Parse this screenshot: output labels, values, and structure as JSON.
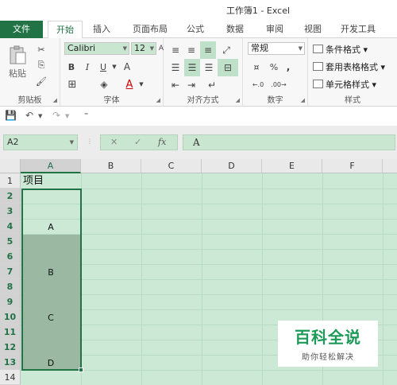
{
  "window": {
    "title": "工作簿1 - Excel"
  },
  "tabs": [
    {
      "label": "文件"
    },
    {
      "label": "开始"
    },
    {
      "label": "插入"
    },
    {
      "label": "页面布局"
    },
    {
      "label": "公式"
    },
    {
      "label": "数据"
    },
    {
      "label": "审阅"
    },
    {
      "label": "视图"
    },
    {
      "label": "开发工具"
    }
  ],
  "ribbon": {
    "clipboard": {
      "label": "剪贴板",
      "paste_label": "粘贴"
    },
    "font": {
      "label": "字体",
      "family": "Calibri",
      "size": "12",
      "grow_label": "A",
      "shrink_label": "A",
      "bold": "B",
      "italic": "I",
      "underline": "U",
      "font_color_label": "A"
    },
    "alignment": {
      "label": "对齐方式"
    },
    "number": {
      "label": "数字",
      "format": "常规"
    },
    "styles": {
      "label": "样式",
      "conditional": "条件格式",
      "table": "套用表格格式",
      "cell": "单元格样式"
    }
  },
  "formula_bar": {
    "name_box": "A2",
    "fx": "fx",
    "cancel": "✕",
    "enter": "✓",
    "content": "A"
  },
  "sheet": {
    "columns": [
      "A",
      "B",
      "C",
      "D",
      "E",
      "F"
    ],
    "rows": [
      "1",
      "2",
      "3",
      "4",
      "5",
      "6",
      "7",
      "8",
      "9",
      "10",
      "11",
      "12",
      "13",
      "14"
    ],
    "cells": {
      "A1": "项目",
      "A4": "A",
      "A7": "B",
      "A10": "C",
      "A13": "D"
    }
  },
  "watermark": {
    "title": "百科全说",
    "subtitle": "助你轻松解决"
  },
  "colors": {
    "accent": "#217346",
    "sheet_bg": "#cbe9d4",
    "selection_fill": "#9bb8a3"
  }
}
